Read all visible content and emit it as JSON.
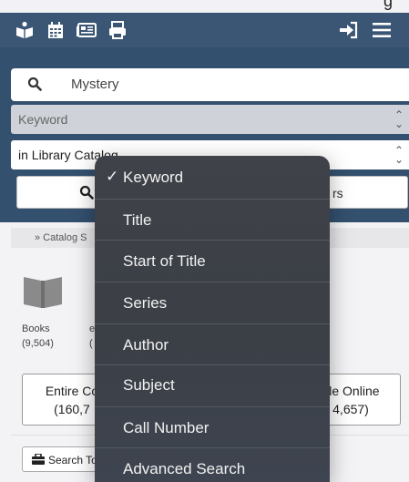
{
  "status_bar": {
    "partial_text": "g"
  },
  "header": {
    "icons": [
      "reading-person-icon",
      "calendar-icon",
      "newspaper-icon",
      "print-icon",
      "login-icon",
      "menu-icon"
    ],
    "color": "#3b5574"
  },
  "search": {
    "query": "Mystery",
    "search_by": "Keyword",
    "scope": "in Library Catalog",
    "button_partial": "rs"
  },
  "breadcrumb": "» Catalog S",
  "facets": {
    "format_items": [
      {
        "label": "Books",
        "count": "(9,504)"
      },
      {
        "label": "e",
        "count": "("
      }
    ],
    "collection_buttons": [
      {
        "line1": "Entire Co",
        "line2": "(160,7"
      },
      {
        "line1": "ble Online",
        "line2": "4,657)"
      }
    ]
  },
  "search_tools_label": "Search To",
  "dropdown": {
    "options": [
      {
        "label": "Keyword",
        "selected": true
      },
      {
        "label": "Title",
        "selected": false
      },
      {
        "label": "Start of Title",
        "selected": false
      },
      {
        "label": "Series",
        "selected": false
      },
      {
        "label": "Author",
        "selected": false
      },
      {
        "label": "Subject",
        "selected": false
      },
      {
        "label": "Call Number",
        "selected": false
      },
      {
        "label": "Advanced Search",
        "selected": false
      }
    ],
    "check_mark": "✓"
  },
  "colors": {
    "header": "#3b5574",
    "band": "#33506e",
    "menu_bg": "#3d4047",
    "menu_text": "#f2f2f2"
  }
}
